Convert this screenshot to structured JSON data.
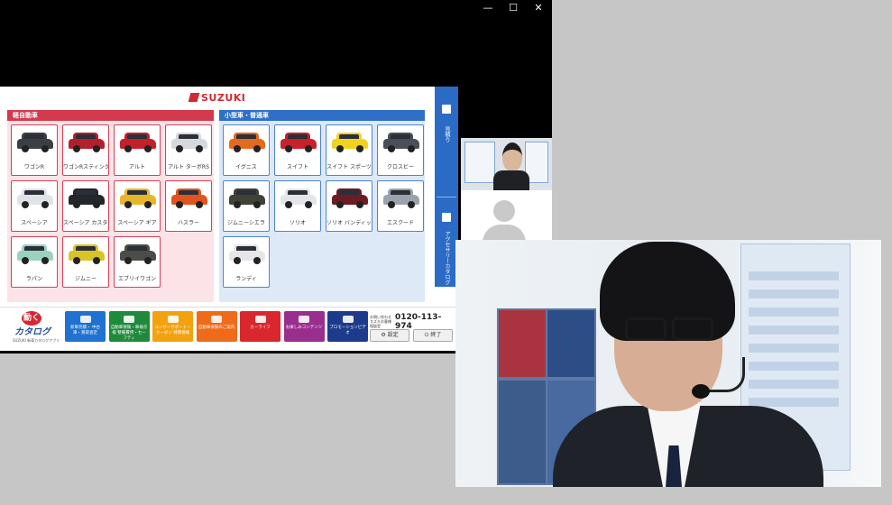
{
  "window": {
    "controls": [
      "—",
      "☐",
      "✕"
    ]
  },
  "app": {
    "brand": "SUZUKI",
    "sections": [
      {
        "title": "軽自動車",
        "cars": [
          {
            "name": "ワゴンR",
            "color": "#3b3f45"
          },
          {
            "name": "ワゴンRスティングレー",
            "color": "#b3202c"
          },
          {
            "name": "アルト",
            "color": "#c4202a"
          },
          {
            "name": "アルト ターボRS",
            "color": "#d5d8dc"
          },
          {
            "name": "スペーシア",
            "color": "#dfe2e6"
          },
          {
            "name": "スペーシア カスタム",
            "color": "#24272c"
          },
          {
            "name": "スペーシア ギア",
            "color": "#e8b629"
          },
          {
            "name": "ハスラー",
            "color": "#e0541f"
          },
          {
            "name": "ラパン",
            "color": "#9bd1bf"
          },
          {
            "name": "ジムニー",
            "color": "#d9c427"
          },
          {
            "name": "エブリイワゴン",
            "color": "#4a4d48"
          }
        ]
      },
      {
        "title": "小型車・普通車",
        "cars": [
          {
            "name": "イグニス",
            "color": "#e36a1e"
          },
          {
            "name": "スイフト",
            "color": "#c9202b"
          },
          {
            "name": "スイフト スポーツ",
            "color": "#f0d21f"
          },
          {
            "name": "クロスビー",
            "color": "#4a4f57"
          },
          {
            "name": "ジムニーシエラ",
            "color": "#3e4237"
          },
          {
            "name": "ソリオ",
            "color": "#e3e5e8"
          },
          {
            "name": "ソリオ バンディット",
            "color": "#6d1b25"
          },
          {
            "name": "エスクード",
            "color": "#9aa3ac"
          },
          {
            "name": "ランディ",
            "color": "#e4e6e9"
          }
        ]
      }
    ],
    "sidebar": {
      "top_label": "見積り",
      "bottom_label": "アクセサリーカタログ"
    },
    "logo": {
      "top": "動く",
      "main": "カタログ",
      "sub": "SUZUKI 新車カタログアプリ"
    },
    "footer_buttons": [
      {
        "label": "新車見積・ 中古車・買取査定",
        "color": "#1f72d0",
        "icon": "car-icon"
      },
      {
        "label": "自動車保険・車検点検 整備費用・セーフティ",
        "color": "#1f8a3b",
        "icon": "truck-icon"
      },
      {
        "label": "ユーザーサポート・クーポン 特典情報",
        "color": "#f3a20f",
        "icon": "coupon-icon"
      },
      {
        "label": "自動車保険のご案内",
        "color": "#ef6b1a",
        "icon": "wrench-icon"
      },
      {
        "label": "カーライフ",
        "color": "#d9272e",
        "icon": "car-life-icon"
      },
      {
        "label": "お楽しみコンテンツ",
        "color": "#9a2e8e",
        "icon": "palette-icon"
      },
      {
        "label": "プロモーションビデオ",
        "color": "#1c3b8c",
        "icon": "play-icon"
      }
    ],
    "contact": {
      "text": "お問い合わせ スズキお客様相談室",
      "number": "0120-113-974"
    },
    "bottom_buttons": {
      "settings": "⚙ 設定",
      "exit": "⏻ 終了"
    }
  }
}
